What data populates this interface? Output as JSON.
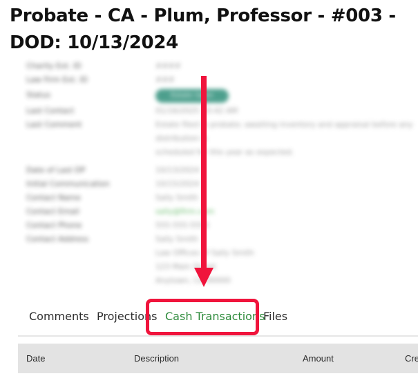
{
  "header": {
    "title": "Probate - CA - Plum, Professor - #003 - DOD: 10/13/2024"
  },
  "details": [
    {
      "label": "Charity Ext. ID",
      "value": [
        "####"
      ]
    },
    {
      "label": "Law Firm Ext. ID",
      "value": [
        "###"
      ]
    },
    {
      "label": "Status",
      "value": [
        "Estate Open"
      ],
      "type": "pill"
    },
    {
      "label": "Last Contact",
      "value": [
        "01/16/2025 10:42 AM"
      ]
    },
    {
      "label": "Last Comment",
      "value": [
        "Estate filed in probate; awaiting inventory and appraisal before any distribution is",
        "scheduled for this year as expected."
      ]
    },
    {
      "label": "Date of Last DP",
      "value": [
        "10/13/2024"
      ]
    },
    {
      "label": "Initial Communication",
      "value": [
        "10/15/2024"
      ]
    },
    {
      "label": "Contact Name",
      "value": [
        "Sally Smith"
      ]
    },
    {
      "label": "Contact Email",
      "value": [
        "sally@firm.com"
      ],
      "type": "link"
    },
    {
      "label": "Contact Phone",
      "value": [
        "555-555-5555"
      ]
    },
    {
      "label": "Contact Address",
      "value": [
        "Sally Smith",
        "Law Offices of Sally Smith",
        "123 Main Street",
        "Anytown, CA 90000"
      ]
    }
  ],
  "tabs": [
    {
      "label": "Comments",
      "active": false
    },
    {
      "label": "Projections",
      "active": false
    },
    {
      "label": "Cash Transactions",
      "active": true
    },
    {
      "label": "Files",
      "active": false
    }
  ],
  "table": {
    "columns": [
      "Date",
      "Description",
      "Amount",
      "Cre"
    ]
  },
  "colors": {
    "accent": "#2e8b3c",
    "annotation": "#f0143c",
    "header_bg": "#e3e3e3",
    "status_pill": "#2f8f7a"
  }
}
